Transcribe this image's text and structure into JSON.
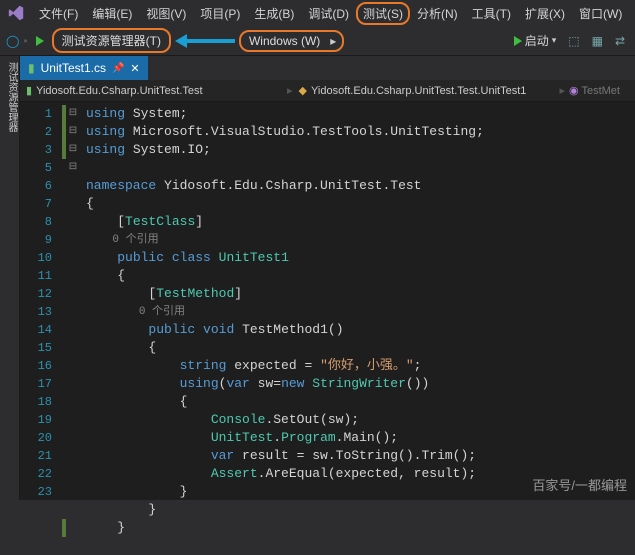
{
  "menubar": {
    "items": [
      "文件(F)",
      "编辑(E)",
      "视图(V)",
      "项目(P)",
      "生成(B)",
      "调试(D)",
      "测试(S)",
      "分析(N)",
      "工具(T)",
      "扩展(X)",
      "窗口(W)"
    ],
    "highlighted_index": 6
  },
  "toolbar": {
    "explorer_label": "测试资源管理器(T)",
    "windows_label": "Windows (W)",
    "start_label": "启动"
  },
  "sidebar_left": {
    "label": "测试资源管理器"
  },
  "tabs": {
    "active": "UnitTest1.cs"
  },
  "breadcrumb": {
    "left": "Yidosoft.Edu.Csharp.UnitTest.Test",
    "right": "Yidosoft.Edu.Csharp.UnitTest.Test.UnitTest1",
    "far": "TestMet"
  },
  "code": {
    "lines": [
      1,
      2,
      3,
      "",
      5,
      6,
      7,
      "",
      8,
      9,
      10,
      "",
      11,
      12,
      13,
      14,
      15,
      16,
      17,
      18,
      19,
      20,
      21,
      22,
      23
    ],
    "lens1": "0 个引用",
    "lens2": "0 个引用",
    "l1": "using System;",
    "l2": "using Microsoft.VisualStudio.TestTools.UnitTesting;",
    "l3": "using System.IO;",
    "l5": "namespace Yidosoft.Edu.Csharp.UnitTest.Test",
    "attr1": "[TestClass]",
    "l8": "public class UnitTest1",
    "attr2": "[TestMethod]",
    "l11": "public void TestMethod1()",
    "l13": "string expected = \"你好，小强。\";",
    "l14": "using(var sw=new StringWriter())",
    "l16": "Console.SetOut(sw);",
    "l17": "UnitTest.Program.Main();",
    "l18": "var result = sw.ToString().Trim();",
    "l19": "Assert.AreEqual(expected, result);"
  },
  "watermark": "百家号/一都编程"
}
